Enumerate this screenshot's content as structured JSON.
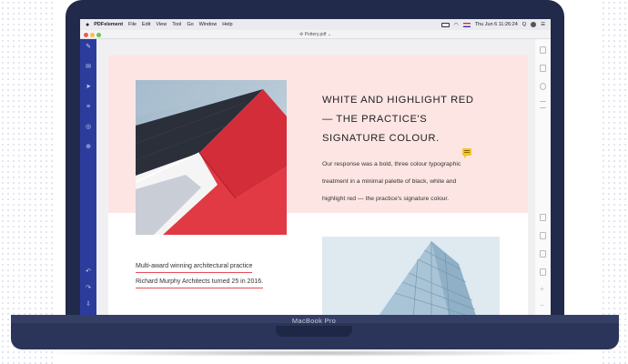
{
  "menubar": {
    "apple": "",
    "app_name": "PDFelement",
    "items": [
      "File",
      "Edit",
      "View",
      "Tool",
      "Go",
      "Window",
      "Help"
    ],
    "clock": "Thu Jun 6  11:26:24",
    "search_glyph": "Q"
  },
  "window": {
    "doc_title": "✣ Pottery.pdf  ⌄"
  },
  "document": {
    "heading_line1": "WHITE AND HIGHLIGHT RED",
    "heading_line2": "— THE PRACTICE'S",
    "heading_line3": "SIGNATURE COLOUR.",
    "body_line1": "Our response was a bold, three colour typographic",
    "body_line2": "treatment in a minimal palette of black, white and",
    "body_line3": "highlight red — the practice's signature colour.",
    "caption_line1": "Multi-award winning architectural practice",
    "caption_line2": "Richard Murphy Architects turned 25 in 2016."
  },
  "device": {
    "label": "MacBook Pro"
  },
  "colors": {
    "laptop_body": "#212a4a",
    "sidebar": "#2c3c9c",
    "pink_band": "#fde5e4",
    "accent_red": "#e94c5a",
    "comment_yellow": "#f3c52c"
  },
  "icons": [
    "apple-icon",
    "pen-icon",
    "mail-icon",
    "send-icon",
    "list-icon",
    "compass-icon",
    "stamp-icon",
    "undo-icon",
    "redo-icon",
    "export-icon",
    "wifi-icon",
    "battery-icon",
    "comment-icon"
  ]
}
